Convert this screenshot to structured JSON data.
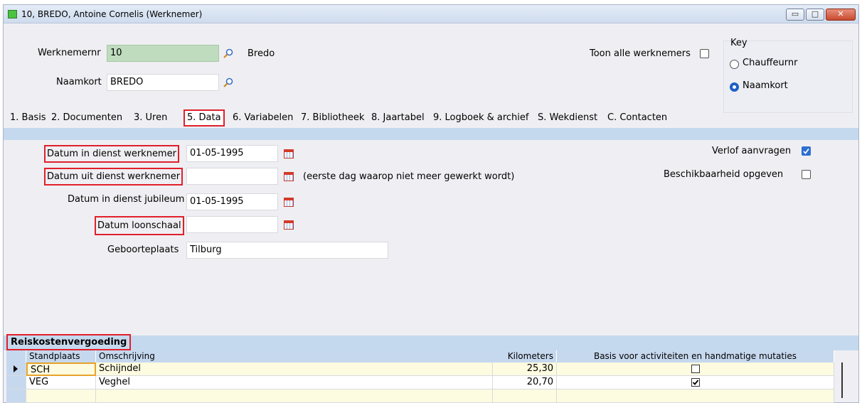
{
  "window": {
    "title": "10, BREDO, Antoine Cornelis (Werknemer)",
    "minimize": "▭",
    "maximize": "□",
    "close": "✕"
  },
  "header": {
    "werknemernr_label": "Werknemernr",
    "werknemernr_value": "10",
    "werknemer_name": "Bredo",
    "naamkort_label": "Naamkort",
    "naamkort_value": "BREDO",
    "toon_alle_label": "Toon alle werknemers",
    "toon_alle_checked": false
  },
  "key": {
    "label": "Key",
    "options": [
      {
        "label": "Chauffeurnr",
        "selected": false
      },
      {
        "label": "Naamkort",
        "selected": true
      }
    ]
  },
  "tabs": [
    {
      "label": "1. Basis",
      "active": false
    },
    {
      "label": "2. Documenten",
      "active": false
    },
    {
      "label": "3. Uren",
      "active": false
    },
    {
      "label": "5. Data",
      "active": true
    },
    {
      "label": "6. Variabelen",
      "active": false
    },
    {
      "label": "7. Bibliotheek",
      "active": false
    },
    {
      "label": "8. Jaartabel",
      "active": false
    },
    {
      "label": "9. Logboek & archief",
      "active": false
    },
    {
      "label": "S. Wekdienst",
      "active": false
    },
    {
      "label": "C. Contacten",
      "active": false
    }
  ],
  "form": {
    "datum_in_dienst_label": "Datum in dienst werknemer",
    "datum_in_dienst_value": "01-05-1995",
    "datum_uit_dienst_label": "Datum uit dienst werknemer",
    "datum_uit_dienst_value": "",
    "datum_uit_note": "(eerste dag waarop niet meer gewerkt wordt)",
    "jubileum_label": "Datum in dienst jubileum",
    "jubileum_value": "01-05-1995",
    "loonschaal_label": "Datum loonschaal",
    "loonschaal_value": "",
    "geboorteplaats_label": "Geboorteplaats",
    "geboorteplaats_value": "Tilburg",
    "verlof_label": "Verlof aanvragen",
    "verlof_checked": true,
    "beschikbaarheid_label": "Beschikbaarheid opgeven",
    "beschikbaarheid_checked": false
  },
  "reiskosten": {
    "title": "Reiskostenvergoeding",
    "columns": [
      "Standplaats",
      "Omschrijving",
      "Kilometers",
      "Basis voor activiteiten en handmatige mutaties"
    ],
    "rows": [
      {
        "standplaats": "SCH",
        "omschrijving": "Schijndel",
        "kilometers": "25,30",
        "basis": false,
        "current": true
      },
      {
        "standplaats": "VEG",
        "omschrijving": "Veghel",
        "kilometers": "20,70",
        "basis": true,
        "current": false
      }
    ]
  },
  "colors": {
    "accent_blue": "#c5d9ee",
    "highlight_red": "#e0202a",
    "current_row": "#fdfbe0",
    "werknemernr_bg": "#bfdcbf"
  }
}
